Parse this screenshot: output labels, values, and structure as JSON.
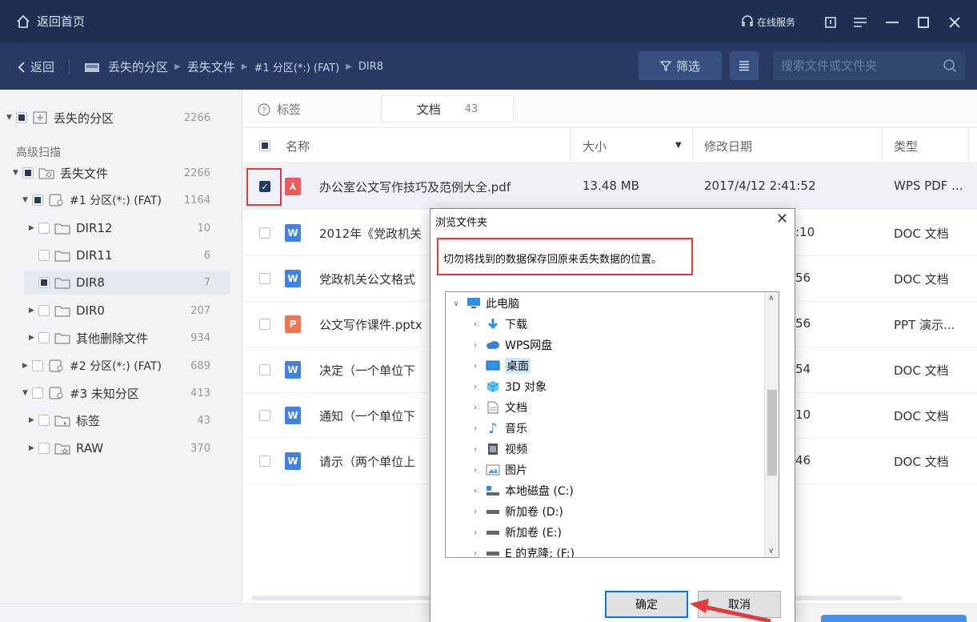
{
  "titlebar": {
    "home_label": "返回首页",
    "service_label": "在线服务"
  },
  "nav": {
    "back_label": "返回",
    "breadcrumb": [
      "丢失的分区",
      "丢失文件",
      "#1 分区(*:) (FAT)",
      "DIR8"
    ],
    "filter_label": "筛选",
    "search_placeholder": "搜索文件或文件夹"
  },
  "sidebar": {
    "root": {
      "label": "丢失的分区",
      "count": "2266"
    },
    "section_label": "高级扫描",
    "items": [
      {
        "label": "丢失文件",
        "count": "2266"
      },
      {
        "label": "#1 分区(*:) (FAT)",
        "count": "1164"
      },
      {
        "label": "DIR12",
        "count": "10"
      },
      {
        "label": "DIR11",
        "count": "6"
      },
      {
        "label": "DIR8",
        "count": "7"
      },
      {
        "label": "DIR0",
        "count": "207"
      },
      {
        "label": "其他删除文件",
        "count": "934"
      },
      {
        "label": "#2 分区(*:) (FAT)",
        "count": "689"
      },
      {
        "label": "#3 未知分区",
        "count": "413"
      },
      {
        "label": "标签",
        "count": "43"
      },
      {
        "label": "RAW",
        "count": "370"
      }
    ]
  },
  "tagbar": {
    "label": "标签",
    "chip_label": "文档",
    "chip_count": "43"
  },
  "table": {
    "headers": {
      "name": "名称",
      "size": "大小",
      "date": "修改日期",
      "type": "类型"
    },
    "rows": [
      {
        "name": "办公室公文写作技巧及范例大全.pdf",
        "size": "13.48 MB",
        "date": "2017/4/12 2:41:52",
        "type": "WPS PDF ..."
      },
      {
        "name": "2012年《党政机关",
        "size": "",
        "date": ":10",
        "type": "DOC 文档"
      },
      {
        "name": "党政机关公文格式",
        "size": "",
        "date": "56",
        "type": "DOC 文档"
      },
      {
        "name": "公文写作课件.pptx",
        "size": "",
        "date": "56",
        "type": "PPT 演示..."
      },
      {
        "name": "决定（一个单位下",
        "size": "",
        "date": "54",
        "type": "DOC 文档"
      },
      {
        "name": "通知（一个单位下",
        "size": "",
        "date": "10",
        "type": "DOC 文档"
      },
      {
        "name": "请示（两个单位上",
        "size": "",
        "date": "46",
        "type": "DOC 文档"
      }
    ]
  },
  "dialog": {
    "title": "浏览文件夹",
    "message": "切勿将找到的数据保存回原来丢失数据的位置。",
    "tree": [
      {
        "label": "此电脑"
      },
      {
        "label": "下载"
      },
      {
        "label": "WPS网盘"
      },
      {
        "label": "桌面"
      },
      {
        "label": "3D 对象"
      },
      {
        "label": "文档"
      },
      {
        "label": "音乐"
      },
      {
        "label": "视频"
      },
      {
        "label": "图片"
      },
      {
        "label": "本地磁盘 (C:)"
      },
      {
        "label": "新加卷 (D:)"
      },
      {
        "label": "新加卷 (E:)"
      },
      {
        "label": "E 的克隆:  (F:)"
      }
    ],
    "ok_label": "确定",
    "cancel_label": "取消"
  },
  "colors": {
    "titlebar": "#1f2f52",
    "navbar": "#263a63",
    "highlight_red": "#e23b3b",
    "dialog_accent": "#0078d7"
  }
}
